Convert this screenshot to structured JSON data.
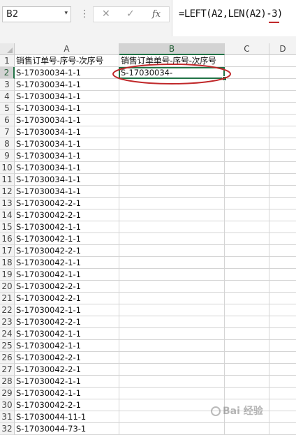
{
  "formula_bar": {
    "name_box": "B2",
    "name_box_arrow": "▾",
    "separator": "⋮",
    "cancel_icon": "✕",
    "enter_icon": "✓",
    "fx_label": "fx",
    "formula": "=LEFT(A2,LEN(A2)-3)"
  },
  "columns": [
    "A",
    "B",
    "C",
    "D"
  ],
  "selected_column": "B",
  "selected_row": 2,
  "cells": {
    "A1": "销售订单号-序号-次序号",
    "B1": "销售订单单号-序号-次序号",
    "B2": "S-17030034-"
  },
  "column_a": [
    "S-17030034-1-1",
    "S-17030034-1-1",
    "S-17030034-1-1",
    "S-17030034-1-1",
    "S-17030034-1-1",
    "S-17030034-1-1",
    "S-17030034-1-1",
    "S-17030034-1-1",
    "S-17030034-1-1",
    "S-17030034-1-1",
    "S-17030034-1-1",
    "S-17030042-2-1",
    "S-17030042-2-1",
    "S-17030042-1-1",
    "S-17030042-1-1",
    "S-17030042-2-1",
    "S-17030042-1-1",
    "S-17030042-1-1",
    "S-17030042-2-1",
    "S-17030042-2-1",
    "S-17030042-1-1",
    "S-17030042-2-1",
    "S-17030042-1-1",
    "S-17030042-1-1",
    "S-17030042-2-1",
    "S-17030042-2-1",
    "S-17030042-1-1",
    "S-17030042-1-1",
    "S-17030042-2-1",
    "S-17030044-11-1",
    "S-17030044-73-1"
  ],
  "row_numbers": [
    "1",
    "2",
    "3",
    "4",
    "5",
    "6",
    "7",
    "8",
    "9",
    "10",
    "11",
    "12",
    "13",
    "14",
    "15",
    "16",
    "17",
    "18",
    "19",
    "20",
    "21",
    "22",
    "23",
    "24",
    "25",
    "26",
    "27",
    "28",
    "29",
    "30",
    "31",
    "32"
  ],
  "watermark": "Bai 经验",
  "colors": {
    "accent_green": "#217346",
    "annotation_red": "#c0282a"
  }
}
